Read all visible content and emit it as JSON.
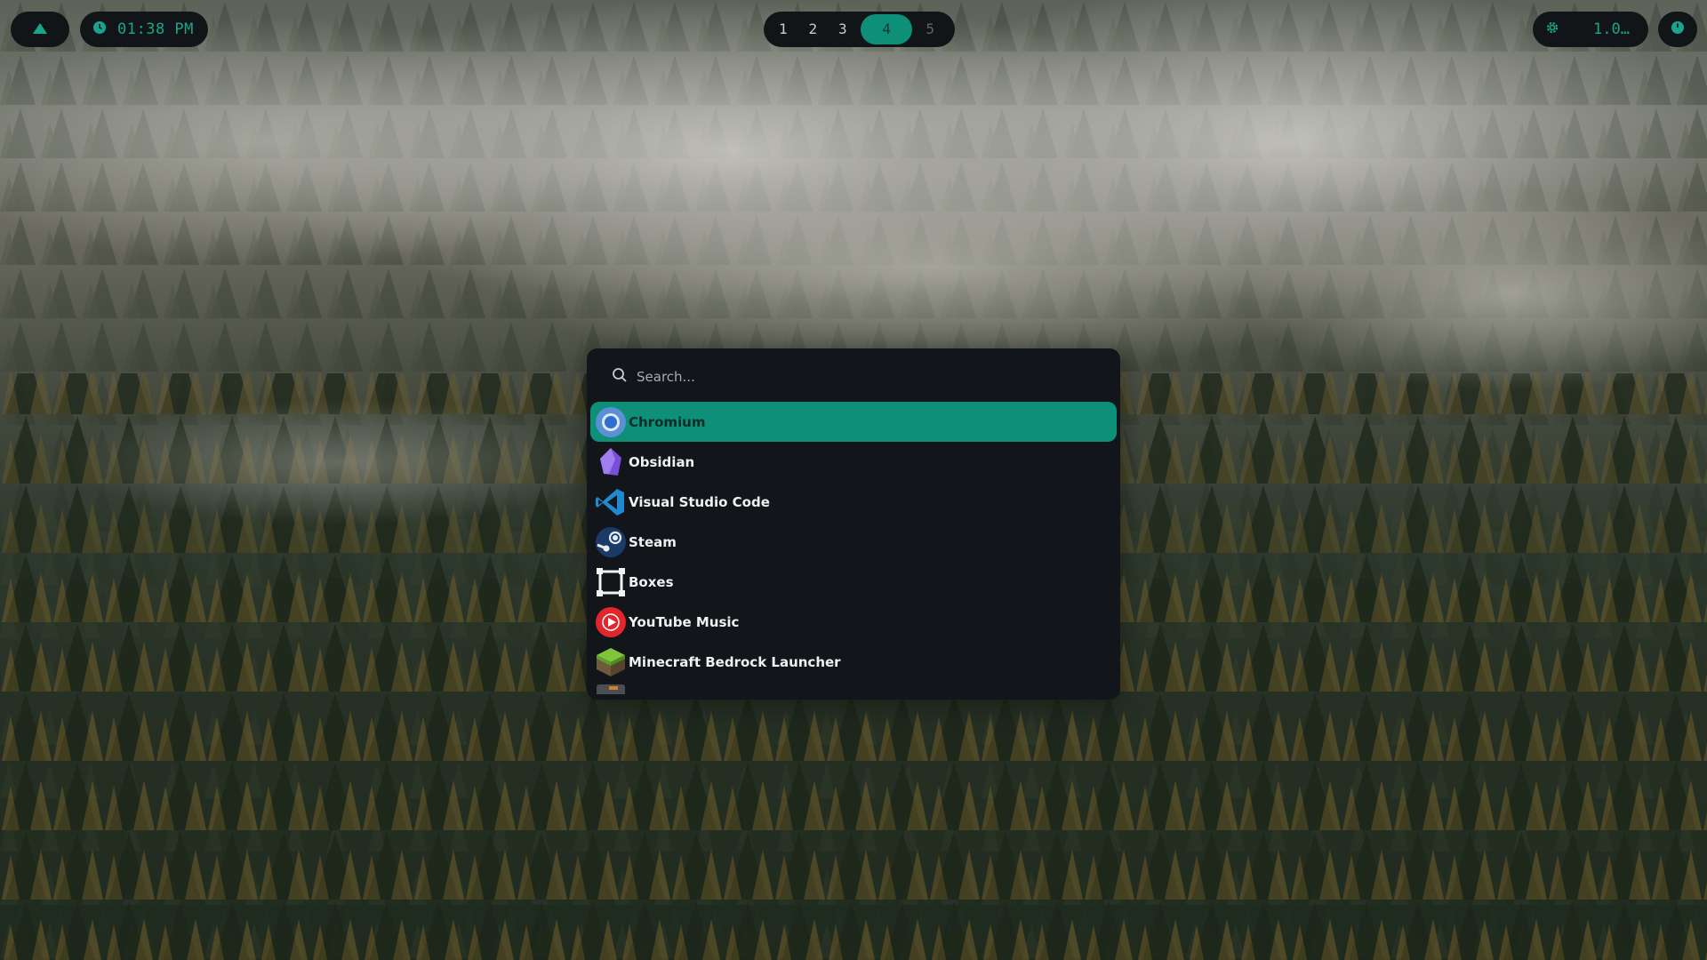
{
  "topbar": {
    "launcher_icon": "cloud-icon",
    "clock": {
      "icon": "clock-icon",
      "time": "01:38 PM"
    },
    "workspaces": [
      {
        "label": "1",
        "state": "normal"
      },
      {
        "label": "2",
        "state": "normal"
      },
      {
        "label": "3",
        "state": "normal"
      },
      {
        "label": "4",
        "state": "active"
      },
      {
        "label": "5",
        "state": "empty"
      }
    ],
    "tray": {
      "icon": "gear-icon",
      "text": "1.0…"
    },
    "power_icon": "power-icon"
  },
  "launcher": {
    "search": {
      "placeholder": "Search...",
      "value": ""
    },
    "apps": [
      {
        "label": "Chromium",
        "icon": "chromium-icon",
        "selected": true
      },
      {
        "label": "Obsidian",
        "icon": "obsidian-icon",
        "selected": false
      },
      {
        "label": "Visual Studio Code",
        "icon": "vscode-icon",
        "selected": false
      },
      {
        "label": "Steam",
        "icon": "steam-icon",
        "selected": false
      },
      {
        "label": "Boxes",
        "icon": "boxes-icon",
        "selected": false
      },
      {
        "label": "YouTube Music",
        "icon": "youtube-music-icon",
        "selected": false
      },
      {
        "label": "Minecraft Bedrock Launcher",
        "icon": "minecraft-icon",
        "selected": false
      }
    ]
  },
  "colors": {
    "accent": "#0e8f78",
    "accent_text": "#1aa58a",
    "panel": "#121519"
  }
}
